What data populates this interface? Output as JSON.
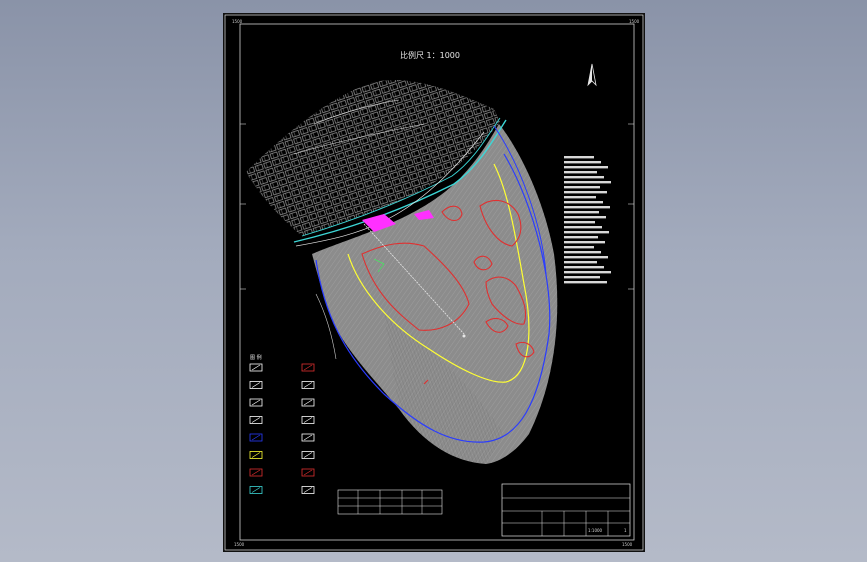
{
  "drawing": {
    "title": "比例尺  1：1000",
    "border_marks": {
      "top_left": "1500",
      "top_right": "1500",
      "bottom_left": "1500",
      "bottom_right": "1500"
    }
  },
  "legend": {
    "heading": "图  例",
    "items": [
      {
        "label": "",
        "color": "#ffffff"
      },
      {
        "label": "",
        "color": "#e03030"
      },
      {
        "label": "",
        "color": "#ffffff"
      },
      {
        "label": "",
        "color": "#ffffff"
      },
      {
        "label": "",
        "color": "#ffffff"
      },
      {
        "label": "",
        "color": "#ffffff"
      },
      {
        "label": "",
        "color": "#ffffff"
      },
      {
        "label": "",
        "color": "#ffffff"
      },
      {
        "label": "",
        "color": "#2a3cff"
      },
      {
        "label": "",
        "color": "#ffffff"
      },
      {
        "label": "",
        "color": "#ffff33"
      },
      {
        "label": "",
        "color": "#ffffff"
      },
      {
        "label": "",
        "color": "#e03030"
      },
      {
        "label": "",
        "color": "#e03030"
      },
      {
        "label": "",
        "color": "#3cd6d6"
      },
      {
        "label": "",
        "color": "#ffffff"
      }
    ]
  },
  "table": {
    "title": "",
    "rows": [
      [
        "",
        "",
        "",
        "",
        ""
      ],
      [
        "",
        "",
        "",
        "",
        ""
      ]
    ]
  },
  "title_block": {
    "cells": [
      "",
      "",
      "",
      "1:1000",
      "",
      "1"
    ]
  },
  "colors": {
    "boundary_blue": "#2a3cff",
    "boundary_yellow": "#ffff33",
    "hazard_red": "#e03030",
    "water_cyan": "#3cd6d6",
    "magenta": "#ff30ff",
    "terrain_gray": "#8c8c8c"
  },
  "icons": [
    "north-arrow-icon"
  ]
}
